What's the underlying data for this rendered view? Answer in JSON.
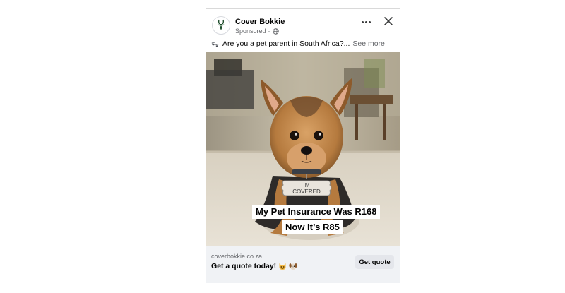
{
  "post": {
    "page_name": "Cover Bokkie",
    "sponsored_label": "Sponsored",
    "meta_separator": "·",
    "caption_text": "Are you a pet parent in South Africa?...",
    "see_more_label": "See more",
    "icons": {
      "avatar": "springbok-logo-icon",
      "privacy": "globe-icon",
      "more": "more-options-icon",
      "close": "close-icon",
      "caption_emoji": "paw-prints-icon"
    }
  },
  "image": {
    "tag_text_line1": "IM",
    "tag_text_line2": "COVERED",
    "overlay_line1": "My Pet Insurance Was R168",
    "overlay_line2": "Now It’s R85"
  },
  "footer": {
    "domain": "coverbokkie.co.za",
    "headline": "Get a quote today!",
    "headline_emojis": [
      "cat-face-icon",
      "dog-face-icon"
    ],
    "cta_label": "Get quote"
  },
  "colors": {
    "brand_green": "#1e4d2b",
    "footer_bg": "#f0f2f5",
    "button_bg": "#e4e6eb",
    "meta_gray": "#65676b"
  }
}
